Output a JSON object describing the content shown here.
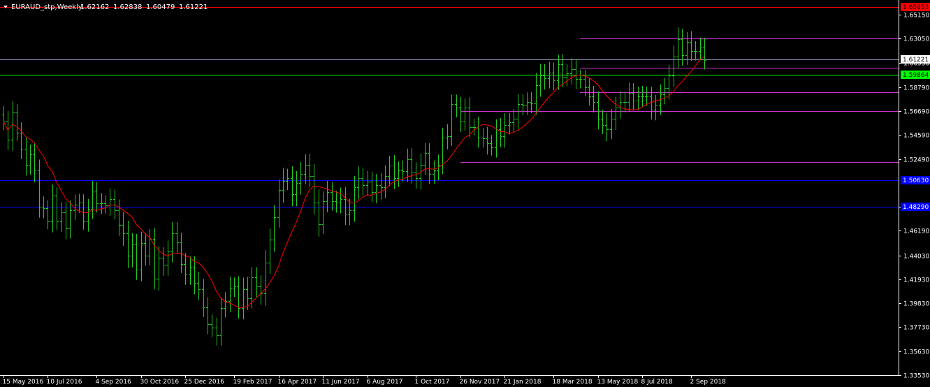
{
  "header": {
    "symbol": "EURAUD_stp,Weekly",
    "open": "1.62162",
    "high": "1.62838",
    "low": "1.60479",
    "close": "1.61221"
  },
  "colors": {
    "background": "#000000",
    "axis": "#ffffff",
    "bar": "#22cc22",
    "ma": "#ff0000",
    "line_red": "#ff0000",
    "line_gray": "#8c8cb4",
    "line_green": "#00ff00",
    "line_magenta": "#cc33cc",
    "line_blue": "#0000ff",
    "tag_blue": "#0000ff",
    "tag_green": "#00ff00",
    "tag_red": "#ff0000",
    "tag_white": "#ffffff"
  },
  "chart_data": {
    "type": "ohlc",
    "title": "",
    "timeframe": "Weekly",
    "ylim": [
      1.3353,
      1.6645
    ],
    "y_ticks": [
      "1.65150",
      "1.63050",
      "1.60950",
      "1.58790",
      "1.56690",
      "1.54590",
      "1.52490",
      "1.48290",
      "1.46190",
      "1.44030",
      "1.41930",
      "1.39830",
      "1.37730",
      "1.35630",
      "1.33530"
    ],
    "x_labels": [
      "15 May 2016",
      "10 Jul 2016",
      "4 Sep 2016",
      "30 Oct 2016",
      "25 Dec 2016",
      "19 Feb 2017",
      "16 Apr 2017",
      "11 Jun 2017",
      "6 Aug 2017",
      "1 Oct 2017",
      "26 Nov 2017",
      "21 Jan 2018",
      "18 Mar 2018",
      "13 May 2018",
      "8 Jul 2018",
      "2 Sep 2018"
    ],
    "bars_close": [
      1.558,
      1.542,
      1.566,
      1.548,
      1.534,
      1.52,
      1.529,
      1.515,
      1.483,
      1.482,
      1.47,
      1.493,
      1.47,
      1.478,
      1.464,
      1.48,
      1.485,
      1.487,
      1.47,
      1.481,
      1.497,
      1.486,
      1.486,
      1.484,
      1.49,
      1.48,
      1.467,
      1.46,
      1.44,
      1.45,
      1.428,
      1.451,
      1.44,
      1.455,
      1.42,
      1.438,
      1.432,
      1.444,
      1.46,
      1.452,
      1.433,
      1.424,
      1.43,
      1.416,
      1.411,
      1.395,
      1.38,
      1.377,
      1.37,
      1.394,
      1.4,
      1.412,
      1.413,
      1.394,
      1.411,
      1.403,
      1.421,
      1.413,
      1.407,
      1.434,
      1.454,
      1.474,
      1.498,
      1.506,
      1.508,
      1.494,
      1.504,
      1.512,
      1.52,
      1.51,
      1.487,
      1.468,
      1.488,
      1.496,
      1.488,
      1.487,
      1.49,
      1.477,
      1.48,
      1.5,
      1.508,
      1.502,
      1.505,
      1.496,
      1.502,
      1.5,
      1.51,
      1.519,
      1.508,
      1.515,
      1.514,
      1.525,
      1.513,
      1.508,
      1.52,
      1.53,
      1.512,
      1.515,
      1.52,
      1.544,
      1.545,
      1.573,
      1.57,
      1.558,
      1.57,
      1.553,
      1.553,
      1.544,
      1.543,
      1.539,
      1.535,
      1.551,
      1.545,
      1.555,
      1.557,
      1.56,
      1.573,
      1.572,
      1.575,
      1.574,
      1.59,
      1.598,
      1.596,
      1.601,
      1.594,
      1.608,
      1.597,
      1.6,
      1.604,
      1.595,
      1.595,
      1.588,
      1.58,
      1.575,
      1.56,
      1.555,
      1.551,
      1.56,
      1.57,
      1.575,
      1.575,
      1.583,
      1.576,
      1.58,
      1.58,
      1.58,
      1.568,
      1.572,
      1.582,
      1.587,
      1.598,
      1.615,
      1.63,
      1.616,
      1.628,
      1.62,
      1.62,
      1.623,
      1.612
    ],
    "bars_range": [
      0.022,
      0.026,
      0.028,
      0.02,
      0.026,
      0.028,
      0.025,
      0.03,
      0.027,
      0.026,
      0.019,
      0.027,
      0.02,
      0.026,
      0.027,
      0.025,
      0.025,
      0.021,
      0.02,
      0.025,
      0.025,
      0.023,
      0.026,
      0.02,
      0.026,
      0.023,
      0.027,
      0.032,
      0.031,
      0.029,
      0.026,
      0.029,
      0.025,
      0.024,
      0.027,
      0.03,
      0.027,
      0.027,
      0.028,
      0.028,
      0.023,
      0.027,
      0.027,
      0.028,
      0.028,
      0.025,
      0.025,
      0.024,
      0.025,
      0.025,
      0.023,
      0.027,
      0.023,
      0.026,
      0.028,
      0.03,
      0.026,
      0.026,
      0.028,
      0.031,
      0.028,
      0.03,
      0.026,
      0.032,
      0.024,
      0.03,
      0.03,
      0.03,
      0.026,
      0.027,
      0.03,
      0.032,
      0.025,
      0.028,
      0.024,
      0.026,
      0.028,
      0.029,
      0.029,
      0.029,
      0.03,
      0.026,
      0.027,
      0.025,
      0.028,
      0.03,
      0.027,
      0.025,
      0.027,
      0.022,
      0.025,
      0.026,
      0.027,
      0.026,
      0.028,
      0.025,
      0.025,
      0.025,
      0.025,
      0.024,
      0.03,
      0.024,
      0.024,
      0.027,
      0.023,
      0.026,
      0.021,
      0.026,
      0.023,
      0.029,
      0.02,
      0.025,
      0.028,
      0.029,
      0.024,
      0.025,
      0.025,
      0.025,
      0.024,
      0.025,
      0.029,
      0.03,
      0.029,
      0.026,
      0.025,
      0.024,
      0.025,
      0.024,
      0.027,
      0.025,
      0.023,
      0.023,
      0.023,
      0.026,
      0.026,
      0.023,
      0.03,
      0.025,
      0.027,
      0.027,
      0.026,
      0.025,
      0.024,
      0.024,
      0.026,
      0.024,
      0.024,
      0.026,
      0.024,
      0.026,
      0.028,
      0.027,
      0.03,
      0.026,
      0.024,
      0.026,
      0.024,
      0.024,
      0.024
    ],
    "ma_period": 10,
    "levels": [
      {
        "price": 1.65853,
        "label": "1.65853",
        "style": "red",
        "start_index": 0
      },
      {
        "price": 1.6305,
        "label": "",
        "style": "magenta",
        "start_index": 130
      },
      {
        "price": 1.61221,
        "label": "1.61221",
        "style": "gray",
        "start_index": 0
      },
      {
        "price": 1.6053,
        "label": "",
        "style": "magenta",
        "start_index": 130
      },
      {
        "price": 1.59864,
        "label": "1.59864",
        "style": "green",
        "start_index": 0
      },
      {
        "price": 1.5835,
        "label": "",
        "style": "magenta",
        "start_index": 130
      },
      {
        "price": 1.5669,
        "label": "",
        "style": "magenta",
        "start_index": 103
      },
      {
        "price": 1.522,
        "label": "",
        "style": "magenta",
        "start_index": 103
      },
      {
        "price": 1.5063,
        "label": "1.50630",
        "style": "blue",
        "start_index": 0
      },
      {
        "price": 1.4829,
        "label": "1.48290",
        "style": "blue",
        "start_index": 0
      }
    ]
  }
}
